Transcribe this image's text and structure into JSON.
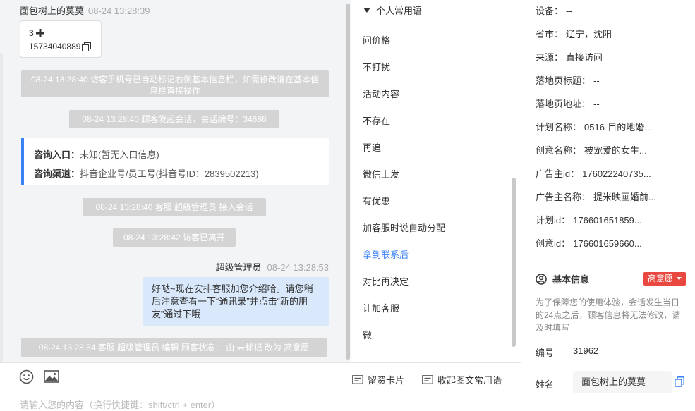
{
  "chat": {
    "sender": {
      "name": "面包树上的莫莫",
      "time": "08-24 13:28:39"
    },
    "card": {
      "line1": "3",
      "line2": "15734040889"
    },
    "sys1": "08-24 13:28:40 访客手机号已自动标记右侧基本信息栏，如需修改请在基本信息栏直接操作",
    "sys2": "08-24 13:28:40 顾客发起会话，会话编号：34686",
    "entry": {
      "label1": "咨询入口：",
      "value1": "未知(暂无入口信息)",
      "label2": "咨询渠道：",
      "value2": "抖音企业号/员工号(抖音号ID：2839502213)"
    },
    "sys3": "08-24 13:28:40 客服 超级管理员 接入会话",
    "sys4": "08-24 13:28:42 访客已离开",
    "agent": {
      "name": "超级管理员",
      "time": "08-24 13:28:53"
    },
    "bubble": "好哒~现在安排客服加您介绍哈。请您稍后注意查看一下“通讯录”并点击“新的朋友”通过下哦",
    "sys5": "08-24 13:28:54 客服 超级管理员 编辑 顾客状态： 由 未标记 改为 高意愿"
  },
  "input": {
    "leave_card": "留资卡片",
    "collapse": "收起图文常用语",
    "placeholder": "请输入您的内容（换行快捷键：shift/ctrl + enter）"
  },
  "phrases": {
    "header": "个人常用语",
    "items": [
      "问价格",
      "不打扰",
      "活动内容",
      "不存在",
      "再追",
      "微信上发",
      "有优惠",
      "加客服时说自动分配",
      "拿到联系后",
      "对比再决定",
      "让加客服",
      "微"
    ],
    "active_index": 8
  },
  "info": {
    "fields": [
      {
        "label": "设备：",
        "value": "--"
      },
      {
        "label": "省市：",
        "value": "辽宁，沈阳"
      },
      {
        "label": "来源：",
        "value": "直接访问"
      },
      {
        "label": "落地页标题：",
        "value": "--"
      },
      {
        "label": "落地页地址：",
        "value": "--"
      },
      {
        "label": "计划名称：",
        "value": "0516-目的地婚..."
      },
      {
        "label": "创意名称：",
        "value": "被宠爱的女生..."
      },
      {
        "label": "广告主id：",
        "value": "176022240735..."
      },
      {
        "label": "广告主名称：",
        "value": "提米映画婚前..."
      },
      {
        "label": "计划id：",
        "value": "176601651859..."
      },
      {
        "label": "创意id：",
        "value": "176601659660..."
      }
    ],
    "basic_title": "基本信息",
    "intent": "高意愿",
    "notice": "为了保障您的使用体验，会话发生当日的24点之后，顾客信息将无法修改，请及时填写",
    "number_label": "编号",
    "number_value": "31962",
    "name_label": "姓名",
    "name_value": "面包树上的莫莫"
  },
  "colors": {
    "accent": "#3b82f6",
    "intent": "#e8483f",
    "bubble": "#d9e8fb",
    "system_pill": "#d4d4d4"
  }
}
